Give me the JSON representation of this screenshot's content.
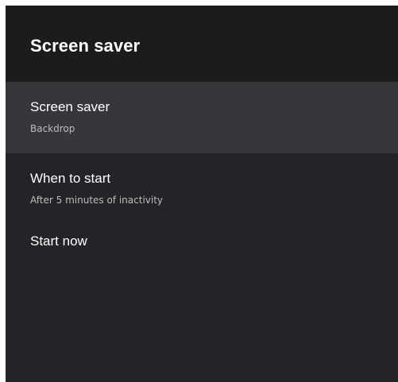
{
  "header": {
    "title": "Screen saver"
  },
  "items": [
    {
      "title": "Screen saver",
      "subtitle": "Backdrop",
      "focused": true
    },
    {
      "title": "When to start",
      "subtitle": "After 5 minutes of inactivity",
      "focused": false
    },
    {
      "title": "Start now",
      "subtitle": "",
      "focused": false
    }
  ],
  "colors": {
    "panel_background": "#232427",
    "header_background": "#1c1c1e",
    "focused_item_background": "#36373b",
    "primary_text": "#ffffff",
    "secondary_text": "#bdbdbd"
  }
}
